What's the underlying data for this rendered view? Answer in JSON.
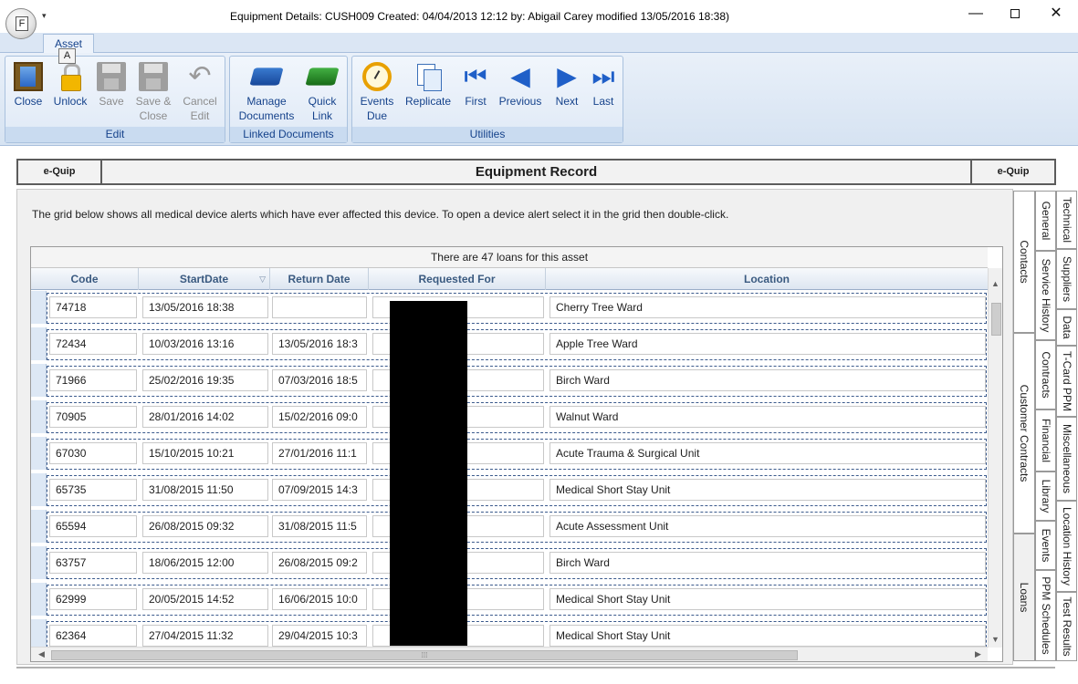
{
  "window": {
    "title": "Equipment Details: CUSH009 Created: 04/04/2013 12:12 by: Abigail Carey modified 13/05/2016 18:38)",
    "orb_letter": "F",
    "qat_arrow": "▾",
    "minimize": "—",
    "close": "✕"
  },
  "ribbon": {
    "tab": "Asset",
    "key_tip": "A",
    "groups": {
      "edit": {
        "label": "Edit",
        "close": "Close",
        "unlock": "Unlock",
        "save": "Save",
        "save_close_1": "Save &",
        "save_close_2": "Close",
        "cancel_edit_1": "Cancel",
        "cancel_edit_2": "Edit"
      },
      "linked": {
        "label": "Linked Documents",
        "manage_1": "Manage",
        "manage_2": "Documents",
        "quick_1": "Quick",
        "quick_2": "Link"
      },
      "utilities": {
        "label": "Utilities",
        "events_1": "Events",
        "events_2": "Due",
        "replicate": "Replicate",
        "first": "First",
        "previous": "Previous",
        "next": "Next",
        "last": "Last"
      }
    }
  },
  "header": {
    "left": "e-Quip",
    "title": "Equipment Record",
    "right": "e-Quip"
  },
  "content": {
    "description": "The grid below shows all medical device alerts which have ever affected this device. To open a device alert select it in the grid then double-click.",
    "grid": {
      "caption": "There are 47 loans for this asset",
      "columns": [
        "Code",
        "StartDate",
        "Return Date",
        "Requested For",
        "Location"
      ],
      "sort_indicator": "▽",
      "rows": [
        {
          "code": "74718",
          "start": "13/05/2016 18:38",
          "return": "",
          "requested": "",
          "location": "Cherry Tree Ward"
        },
        {
          "code": "72434",
          "start": "10/03/2016 13:16",
          "return": "13/05/2016 18:3",
          "requested": "",
          "location": "Apple Tree Ward"
        },
        {
          "code": "71966",
          "start": "25/02/2016 19:35",
          "return": "07/03/2016 18:5",
          "requested": "",
          "location": "Birch Ward"
        },
        {
          "code": "70905",
          "start": "28/01/2016 14:02",
          "return": "15/02/2016 09:0",
          "requested": "",
          "location": "Walnut Ward"
        },
        {
          "code": "67030",
          "start": "15/10/2015 10:21",
          "return": "27/01/2016 11:1",
          "requested": "",
          "location": "Acute Trauma & Surgical Unit"
        },
        {
          "code": "65735",
          "start": "31/08/2015 11:50",
          "return": "07/09/2015 14:3",
          "requested": "",
          "location": "Medical Short Stay Unit"
        },
        {
          "code": "65594",
          "start": "26/08/2015 09:32",
          "return": "31/08/2015 11:5",
          "requested": "",
          "location": "Acute Assessment Unit"
        },
        {
          "code": "63757",
          "start": "18/06/2015 12:00",
          "return": "26/08/2015 09:2",
          "requested": "",
          "location": "Birch Ward"
        },
        {
          "code": "62999",
          "start": "20/05/2015 14:52",
          "return": "16/06/2015 10:0",
          "requested": "",
          "location": "Medical Short Stay Unit"
        },
        {
          "code": "62364",
          "start": "27/04/2015 11:32",
          "return": "29/04/2015 10:3",
          "requested": "",
          "location": "Medical Short Stay Unit"
        }
      ]
    }
  },
  "side_tabs": {
    "outer": [
      "Contacts",
      "Customer Contracts",
      "Loans"
    ],
    "middle": [
      "General",
      "Service History",
      "Contracts",
      "Financial",
      "Library",
      "Events",
      "PPM Schedules"
    ],
    "inner": [
      "Technical",
      "Suppliers",
      "Data",
      "T-Card PPM",
      "Miscellaneous",
      "Location History",
      "Test Results"
    ],
    "selected": "Loans"
  }
}
